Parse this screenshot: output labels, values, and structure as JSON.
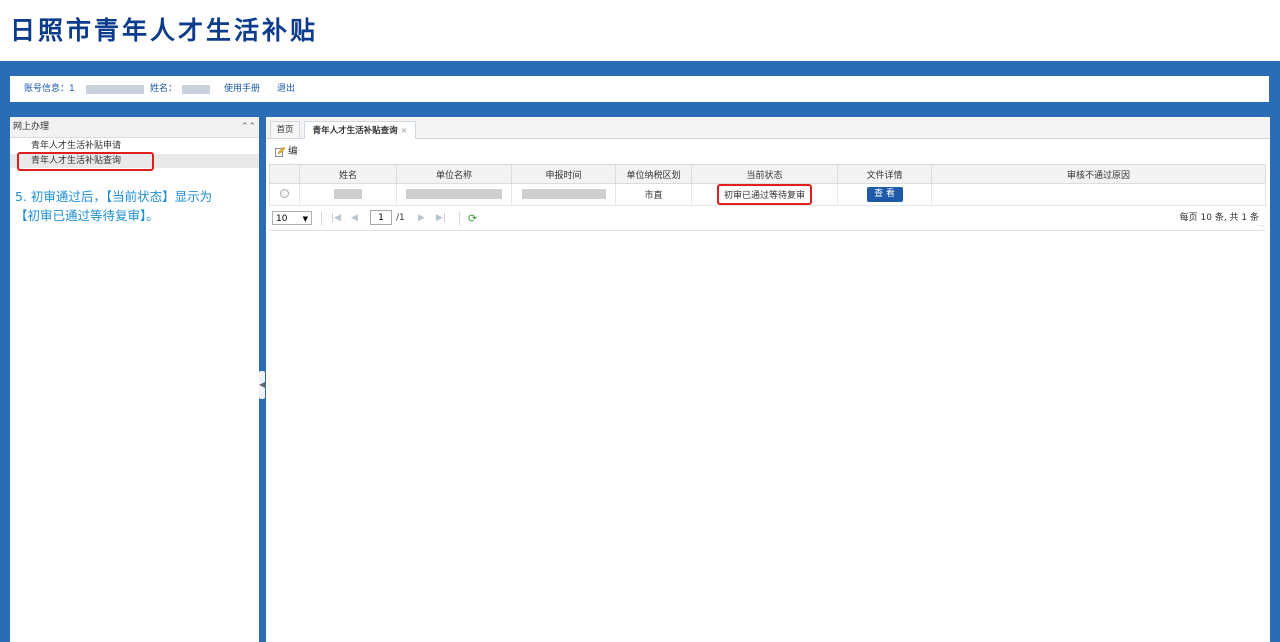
{
  "site": {
    "title": "日照市青年人才生活补贴"
  },
  "info_bar": {
    "account_label": "账号信息：1",
    "name_label": "姓名：",
    "manual_link": "使用手册",
    "logout_link": "退出"
  },
  "sidebar": {
    "title": "网上办理",
    "collapse_icon": "double-chevron-up-icon",
    "items": [
      {
        "label": "青年人才生活补贴申请"
      },
      {
        "label": "青年人才生活补贴查询",
        "selected": true
      }
    ],
    "annotation_line1": "5. 初审通过后，【当前状态】显示为",
    "annotation_line2": "【初审已通过等待复审】。"
  },
  "tabs": [
    {
      "label": "首页"
    },
    {
      "label": "青年人才生活补贴查询",
      "close": "×",
      "active": true
    }
  ],
  "toolbar": {
    "edit_label": "编辑",
    "edit_icon": "pencil-icon"
  },
  "grid": {
    "columns": [
      "姓名",
      "单位名称",
      "申报时间",
      "单位纳税区划",
      "当前状态",
      "文件详情",
      "审核不通过原因"
    ],
    "rows": [
      {
        "name": "",
        "company": "",
        "date": "",
        "tax_region": "市直",
        "status": "初审已通过等待复审",
        "details_button": "查 看",
        "reject_reason": ""
      }
    ]
  },
  "pager": {
    "page_size": "10",
    "current_page": "1",
    "total_pages": "/1",
    "summary": "每页 10 条, 共 1 条"
  },
  "colors": {
    "frame_blue": "#2a6db6",
    "title_blue": "#0d3c8c",
    "annotation_blue": "#1e8fd6",
    "highlight_red": "#e02020",
    "button_blue": "#1e5aa8"
  }
}
